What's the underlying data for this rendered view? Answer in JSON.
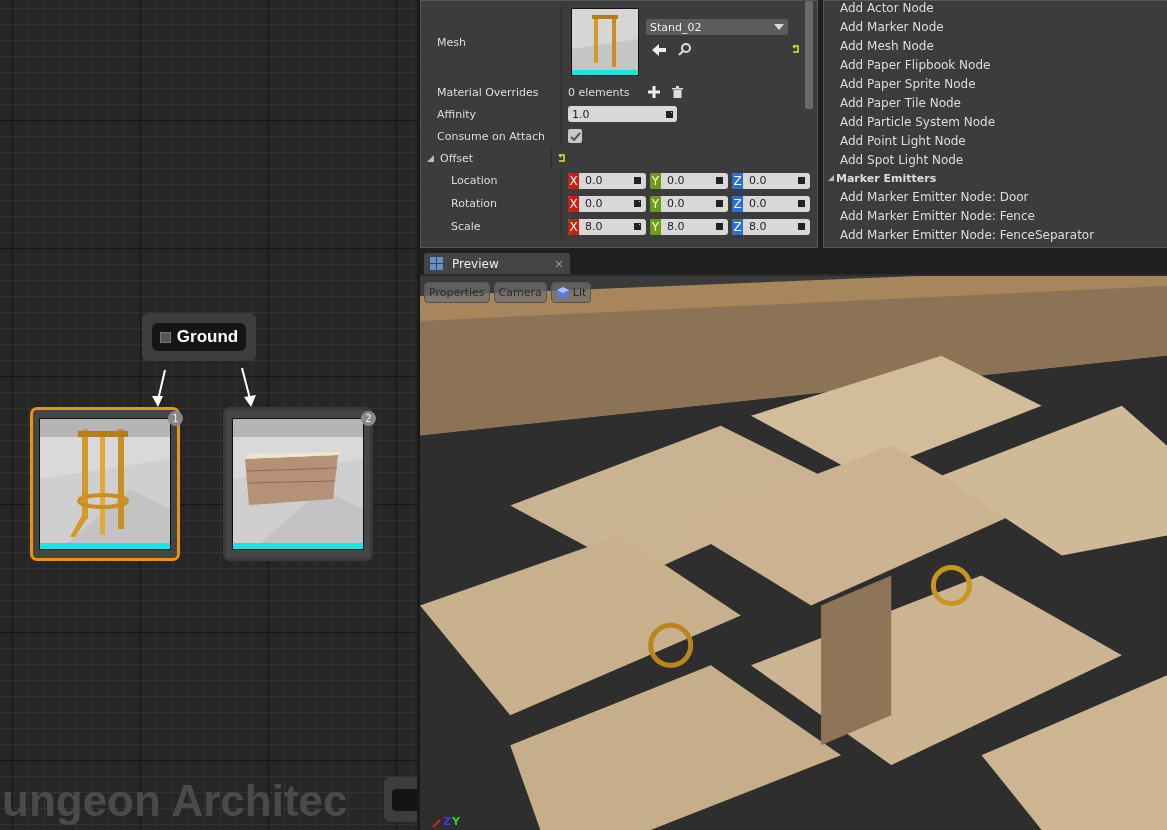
{
  "graph": {
    "watermark": "ungeon Architec",
    "ground_node": {
      "label": "Ground"
    },
    "mesh_nodes": [
      {
        "badge": "1",
        "selected": true,
        "kind": "stand"
      },
      {
        "badge": "2",
        "selected": false,
        "kind": "block"
      }
    ]
  },
  "details": {
    "mesh": {
      "label": "Mesh",
      "value": "Stand_02"
    },
    "material_overrides": {
      "label": "Material Overrides",
      "value": "0 elements"
    },
    "affinity": {
      "label": "Affinity",
      "value": "1.0"
    },
    "consume_on_attach": {
      "label": "Consume on Attach",
      "checked": true
    },
    "offset": {
      "label": "Offset",
      "expanded": true,
      "rows": [
        {
          "label": "Location",
          "fields": [
            {
              "axis": "X",
              "value": "0.0"
            },
            {
              "axis": "Y",
              "value": "0.0"
            },
            {
              "axis": "Z",
              "value": "0.0"
            }
          ]
        },
        {
          "label": "Rotation",
          "fields": [
            {
              "axis": "X",
              "value": "0.0"
            },
            {
              "axis": "Y",
              "value": "0.0"
            },
            {
              "axis": "Z",
              "value": "0.0"
            }
          ]
        },
        {
          "label": "Scale",
          "fields": [
            {
              "axis": "X",
              "value": "8.0"
            },
            {
              "axis": "Y",
              "value": "8.0"
            },
            {
              "axis": "Z",
              "value": "8.0"
            }
          ]
        }
      ]
    }
  },
  "palette": {
    "items": [
      {
        "kind": "item",
        "label": "Add Actor Node"
      },
      {
        "kind": "item",
        "label": "Add Marker Node"
      },
      {
        "kind": "item",
        "label": "Add Mesh Node"
      },
      {
        "kind": "item",
        "label": "Add Paper Flipbook Node"
      },
      {
        "kind": "item",
        "label": "Add Paper Sprite Node"
      },
      {
        "kind": "item",
        "label": "Add Paper Tile Node"
      },
      {
        "kind": "item",
        "label": "Add Particle System Node"
      },
      {
        "kind": "item",
        "label": "Add Point Light Node"
      },
      {
        "kind": "item",
        "label": "Add Spot Light Node"
      },
      {
        "kind": "category",
        "label": "Marker Emitters",
        "expanded": true
      },
      {
        "kind": "item",
        "label": "Add Marker Emitter Node: Door"
      },
      {
        "kind": "item",
        "label": "Add Marker Emitter Node: Fence"
      },
      {
        "kind": "item",
        "label": "Add Marker Emitter Node: FenceSeparator"
      }
    ]
  },
  "preview": {
    "tab": {
      "label": "Preview",
      "close": "×"
    },
    "toolbar": [
      "Properties",
      "Camera",
      "Lit"
    ],
    "gizmo_labels": [
      "Z",
      "Y"
    ]
  }
}
